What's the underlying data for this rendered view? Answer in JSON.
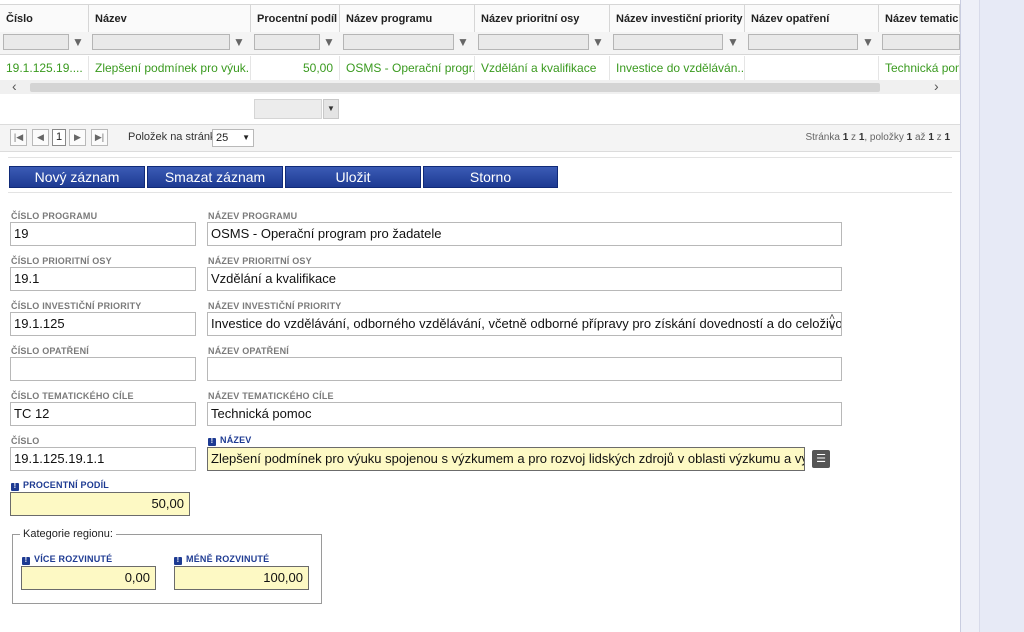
{
  "grid": {
    "columns": [
      "Číslo",
      "Název",
      "Procentní podíl",
      "Název programu",
      "Název prioritní osy",
      "Název investiční priority",
      "Název opatření",
      "Název tematického"
    ],
    "row": [
      "19.1.125.19....",
      "Zlepšení podmínek pro výuk...",
      "50,00",
      "OSMS - Operační progr...",
      "Vzdělání a kvalifikace",
      "Investice do vzděláván...",
      "",
      "Technická pomo"
    ]
  },
  "pager": {
    "page": "1",
    "per_page_label": "Položek na stránku",
    "per_page_value": "25",
    "info_prefix": "Stránka",
    "info_page": "1",
    "info_of": "z",
    "info_pages": "1",
    "info_items": ", položky",
    "info_from": "1",
    "info_to_word": "až",
    "info_to": "1",
    "info_of2": "z",
    "info_total": "1"
  },
  "actions": {
    "new": "Nový záznam",
    "delete": "Smazat záznam",
    "save": "Uložit",
    "cancel": "Storno"
  },
  "form": {
    "cislo_programu": {
      "label": "ČÍSLO PROGRAMU",
      "value": "19"
    },
    "nazev_programu": {
      "label": "NÁZEV PROGRAMU",
      "value": "OSMS - Operační program pro žadatele"
    },
    "cislo_osy": {
      "label": "ČÍSLO PRIORITNÍ OSY",
      "value": "19.1"
    },
    "nazev_osy": {
      "label": "NÁZEV PRIORITNÍ OSY",
      "value": "Vzdělání a kvalifikace"
    },
    "cislo_priority": {
      "label": "ČÍSLO INVESTIČNÍ PRIORITY",
      "value": "19.1.125"
    },
    "nazev_priority": {
      "label": "NÁZEV INVESTIČNÍ PRIORITY",
      "value": "Investice do vzdělávání, odborného vzdělávání, včetně odborné přípravy pro získání dovedností a do celoživotního učení"
    },
    "cislo_opatreni": {
      "label": "ČÍSLO OPATŘENÍ",
      "value": ""
    },
    "nazev_opatreni": {
      "label": "NÁZEV OPATŘENÍ",
      "value": ""
    },
    "cislo_cile": {
      "label": "ČÍSLO TEMATICKÉHO CÍLE",
      "value": "TC 12"
    },
    "nazev_cile": {
      "label": "NÁZEV TEMATICKÉHO CÍLE",
      "value": "Technická pomoc"
    },
    "cislo": {
      "label": "ČÍSLO",
      "value": "19.1.125.19.1.1"
    },
    "nazev": {
      "label": "NÁZEV",
      "value": "Zlepšení podmínek pro výuku spojenou s výzkumem a pro rozvoj lidských zdrojů v oblasti výzkumu a vývoje"
    },
    "procentni_podil": {
      "label": "PROCENTNÍ PODÍL",
      "value": "50,00"
    },
    "kategorie": {
      "legend": "Kategorie regionu:",
      "vice": {
        "label": "VÍCE ROZVINUTÉ",
        "value": "0,00"
      },
      "mene": {
        "label": "MÉNĚ ROZVINUTÉ",
        "value": "100,00"
      }
    }
  },
  "icons": {
    "filter": "filter-icon",
    "list": "list-icon",
    "required": "required-icon"
  }
}
